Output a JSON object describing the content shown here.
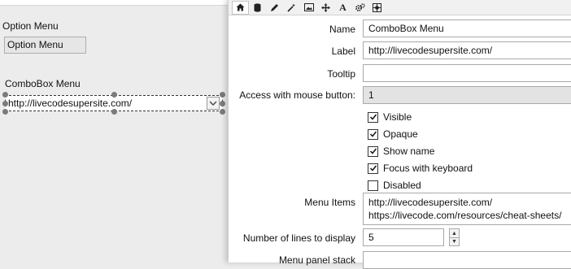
{
  "stack": {
    "option_menu_label": "Option Menu",
    "option_menu_button": "Option Menu",
    "combobox_label": "ComboBox Menu",
    "combobox_value": "http://livecodesupersite.com/"
  },
  "inspector": {
    "toolbar_icons": [
      "home-icon",
      "database-icon",
      "pencil-icon",
      "magic-wand-icon",
      "image-icon",
      "move-icon",
      "text-icon",
      "gears-icon",
      "layout-icon"
    ],
    "name_label": "Name",
    "name_value": "ComboBox Menu",
    "label_label": "Label",
    "label_value": "http://livecodesupersite.com/",
    "tooltip_label": "Tooltip",
    "tooltip_value": "",
    "mouse_label": "Access with mouse button:",
    "mouse_value": "1",
    "checkboxes": [
      {
        "label": "Visible",
        "checked": true
      },
      {
        "label": "Opaque",
        "checked": true
      },
      {
        "label": "Show name",
        "checked": true
      },
      {
        "label": "Focus with keyboard",
        "checked": true
      },
      {
        "label": "Disabled",
        "checked": false
      }
    ],
    "menu_items_label": "Menu Items",
    "menu_items": [
      "http://livecodesupersite.com/",
      "https://livecode.com/resources/cheat-sheets/"
    ],
    "lines_label": "Number of lines to display",
    "lines_value": "5",
    "panel_stack_label": "Menu panel stack"
  }
}
